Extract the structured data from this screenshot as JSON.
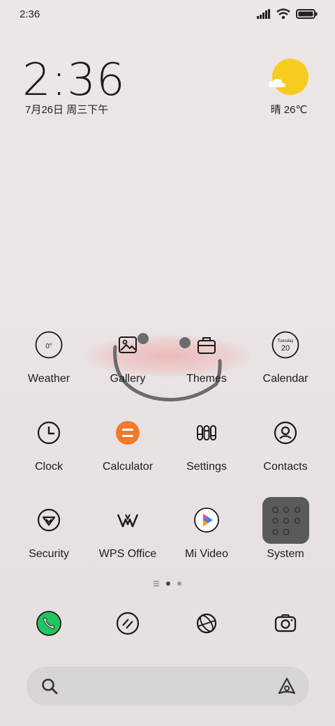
{
  "status_bar": {
    "time": "2:36",
    "icons": [
      "signal-icon",
      "wifi-icon",
      "battery-icon"
    ]
  },
  "clock_widget": {
    "time": "2:36",
    "date": "7月26日 周三下午"
  },
  "weather_widget": {
    "condition_temp": "晴 26℃",
    "icon": "sun-cloud-icon"
  },
  "apps": [
    {
      "label": "Weather",
      "icon": "weather-icon",
      "icon_text": "0°"
    },
    {
      "label": "Gallery",
      "icon": "gallery-icon"
    },
    {
      "label": "Themes",
      "icon": "themes-icon"
    },
    {
      "label": "Calendar",
      "icon": "calendar-icon",
      "icon_text_top": "Tuesday",
      "icon_text_bottom": "20"
    },
    {
      "label": "Clock",
      "icon": "clock-icon"
    },
    {
      "label": "Calculator",
      "icon": "calculator-icon"
    },
    {
      "label": "Settings",
      "icon": "settings-icon"
    },
    {
      "label": "Contacts",
      "icon": "contacts-icon"
    },
    {
      "label": "Security",
      "icon": "security-icon"
    },
    {
      "label": "WPS Office",
      "icon": "wps-office-icon"
    },
    {
      "label": "Mi Video",
      "icon": "mi-video-icon"
    },
    {
      "label": "System",
      "icon": "system-folder-icon"
    }
  ],
  "page_indicator": {
    "pages": 2,
    "current": 1,
    "has_list": true
  },
  "dock": [
    "phone-icon",
    "notes-icon",
    "browser-icon",
    "camera-icon"
  ],
  "search": {
    "icon": "search-icon",
    "assistant": "assistant-icon"
  },
  "colors": {
    "accent_orange": "#f07b2c",
    "phone_green": "#22c55e",
    "sun_yellow": "#f7cc1f"
  }
}
